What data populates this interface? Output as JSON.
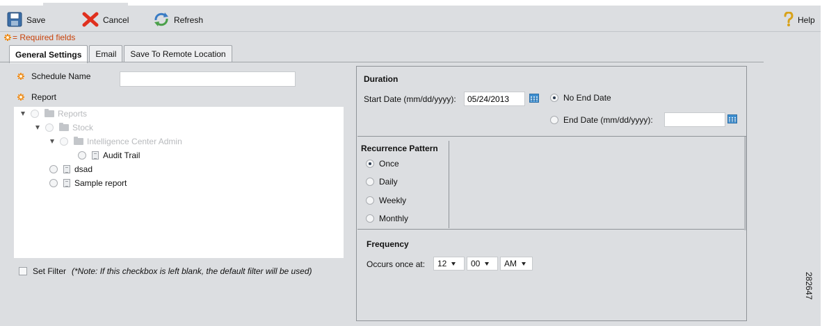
{
  "toolbar": {
    "save_label": "Save",
    "cancel_label": "Cancel",
    "refresh_label": "Refresh",
    "help_label": "Help"
  },
  "required_fields_label": "= Required fields",
  "tabs": [
    {
      "label": "General Settings",
      "active": true
    },
    {
      "label": "Email",
      "active": false
    },
    {
      "label": "Save To Remote Location",
      "active": false
    }
  ],
  "general": {
    "schedule_name_label": "Schedule Name",
    "schedule_name_value": "",
    "report_label": "Report",
    "tree": [
      {
        "label": "Reports",
        "type": "folder",
        "level": 0,
        "expanded": true,
        "disabled": true
      },
      {
        "label": "Stock",
        "type": "folder",
        "level": 1,
        "expanded": true,
        "disabled": true
      },
      {
        "label": "Intelligence Center Admin",
        "type": "folder",
        "level": 2,
        "expanded": true,
        "disabled": true
      },
      {
        "label": "Audit Trail",
        "type": "report",
        "level": 3,
        "disabled": false
      },
      {
        "label": "dsad",
        "type": "report",
        "level": 1,
        "disabled": false
      },
      {
        "label": "Sample report",
        "type": "report",
        "level": 1,
        "disabled": false
      }
    ],
    "set_filter_label": "Set Filter",
    "set_filter_note": "(*Note: If this checkbox is left blank, the default filter will be used)"
  },
  "duration": {
    "title": "Duration",
    "start_date_label": "Start Date (mm/dd/yyyy):",
    "start_date_value": "05/24/2013",
    "no_end_date_label": "No End Date",
    "end_date_label": "End Date (mm/dd/yyyy):",
    "end_date_value": "",
    "selected": "no_end_date"
  },
  "recurrence": {
    "title": "Recurrence Pattern",
    "options": [
      "Once",
      "Daily",
      "Weekly",
      "Monthly"
    ],
    "selected": "Once"
  },
  "frequency": {
    "title": "Frequency",
    "occurs_label": "Occurs once at:",
    "hour": "12",
    "minute": "00",
    "ampm": "AM"
  },
  "side_number": "282647",
  "colors": {
    "background": "#dcdee1",
    "required_star": "#f08a14",
    "required_text": "#c8420a",
    "cancel_x": "#e0301e",
    "calendar_icon": "#3f8fd0"
  }
}
